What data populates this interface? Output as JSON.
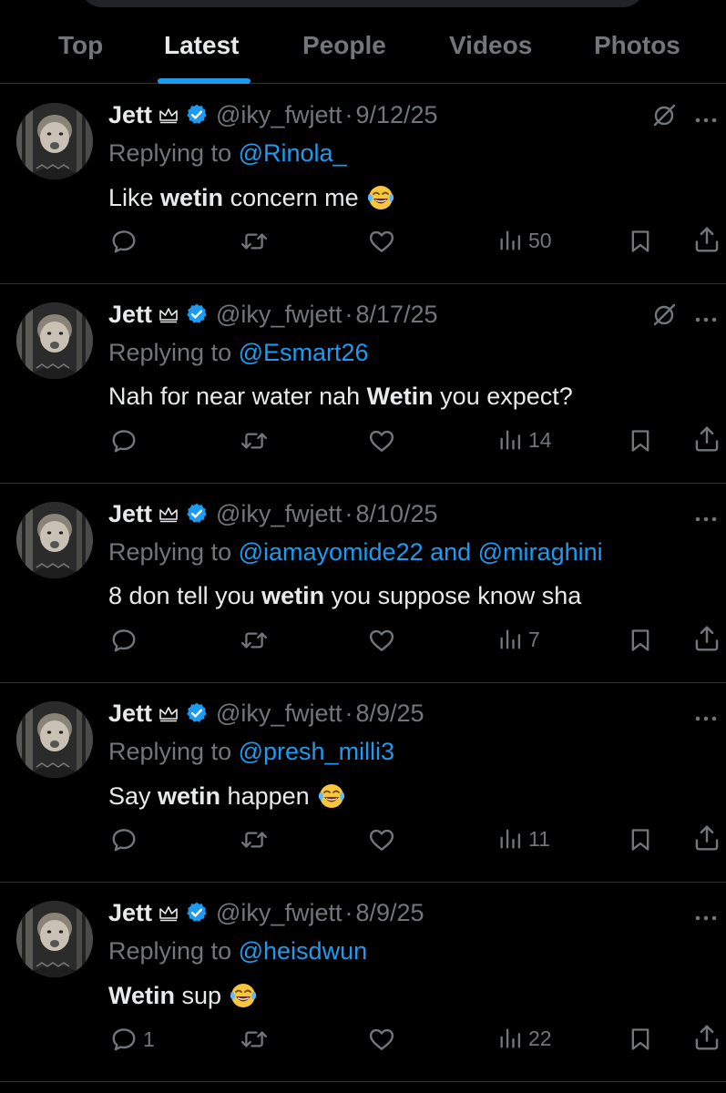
{
  "tabs": [
    {
      "label": "Top"
    },
    {
      "label": "Latest"
    },
    {
      "label": "People"
    },
    {
      "label": "Videos"
    },
    {
      "label": "Photos"
    }
  ],
  "active_tab": "Latest",
  "tweets": [
    {
      "name": "Jett",
      "handle": "@iky_fwjett",
      "date": "9/12/25",
      "reply_prefix": "Replying to",
      "mentions": "@Rinola_",
      "text_parts": [
        "Like ",
        "wetin",
        " concern me"
      ],
      "emoji": "laughing-tears",
      "replies": "",
      "views": "50",
      "grok": true
    },
    {
      "name": "Jett",
      "handle": "@iky_fwjett",
      "date": "8/17/25",
      "reply_prefix": "Replying to",
      "mentions": "@Esmart26",
      "text_parts": [
        "Nah for near water nah ",
        "Wetin",
        " you expect?"
      ],
      "emoji": "",
      "replies": "",
      "views": "14",
      "grok": true
    },
    {
      "name": "Jett",
      "handle": "@iky_fwjett",
      "date": "8/10/25",
      "reply_prefix": "Replying to",
      "mentions": "@iamayomide22 and @miraghini",
      "text_parts": [
        "8 don tell you ",
        "wetin",
        " you suppose know sha"
      ],
      "emoji": "",
      "replies": "",
      "views": "7",
      "grok": false
    },
    {
      "name": "Jett",
      "handle": "@iky_fwjett",
      "date": "8/9/25",
      "reply_prefix": "Replying to",
      "mentions": "@presh_milli3",
      "text_parts": [
        "Say ",
        "wetin",
        " happen"
      ],
      "emoji": "laughing-tears",
      "replies": "",
      "views": "11",
      "grok": false
    },
    {
      "name": "Jett",
      "handle": "@iky_fwjett",
      "date": "8/9/25",
      "reply_prefix": "Replying to",
      "mentions": "@heisdwun",
      "text_parts": [
        "",
        "Wetin",
        " sup"
      ],
      "emoji": "laughing-tears",
      "replies": "1",
      "views": "22",
      "grok": false
    }
  ],
  "colors": {
    "background": "#000000",
    "text": "#e7e9ea",
    "muted": "#71767b",
    "accent": "#1d9bf0",
    "divider": "#2f3336"
  }
}
